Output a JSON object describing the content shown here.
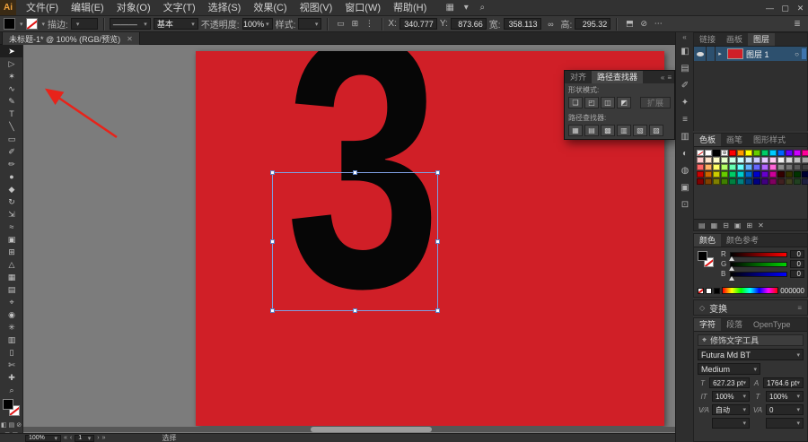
{
  "menubar": {
    "logo": "Ai",
    "items": [
      "文件(F)",
      "编辑(E)",
      "对象(O)",
      "文字(T)",
      "选择(S)",
      "效果(C)",
      "视图(V)",
      "窗口(W)",
      "帮助(H)"
    ],
    "right_icons": [
      {
        "name": "arrange-documents-icon",
        "glyph": "▦"
      },
      {
        "name": "workspace-icon",
        "glyph": "▾"
      },
      {
        "name": "search-icon",
        "glyph": "⌕"
      }
    ],
    "window_controls": [
      {
        "name": "minimize-button",
        "glyph": "—"
      },
      {
        "name": "maximize-button",
        "glyph": "▢"
      },
      {
        "name": "close-button",
        "glyph": "✕"
      }
    ]
  },
  "controlbar": {
    "fill_color": "#000000",
    "stroke_label": "描边:",
    "stroke_weight": "",
    "profile_value": "———",
    "brush_value": "基本",
    "opacity_label": "不透明度:",
    "opacity_value": "100%",
    "style_label": "样式:",
    "x_label": "X:",
    "x_value": "340.777",
    "y_label": "Y:",
    "y_value": "873.66",
    "w_label": "宽:",
    "w_value": "358.113",
    "link_icon": "∞",
    "h_label": "高:",
    "h_value": "295.32",
    "icons_a": [
      {
        "name": "boundingbox-icon",
        "glyph": "▭"
      },
      {
        "name": "align-objects-icon",
        "glyph": "⊞"
      },
      {
        "name": "distribute-icon",
        "glyph": "⋮"
      }
    ],
    "icons_b": [
      {
        "name": "transform-panel-icon",
        "glyph": "⬒"
      },
      {
        "name": "isolate-selection-icon",
        "glyph": "⊘"
      },
      {
        "name": "more-options-icon",
        "glyph": "⋯"
      }
    ],
    "panel_menu_icon": "≣"
  },
  "tabbar": {
    "title": "未标题-1* @ 100% (RGB/预览)",
    "close": "✕"
  },
  "toolbar": {
    "tools": [
      {
        "name": "selection-tool",
        "glyph": "➤"
      },
      {
        "name": "direct-selection-tool",
        "glyph": "▷"
      },
      {
        "name": "magic-wand-tool",
        "glyph": "✶"
      },
      {
        "name": "lasso-tool",
        "glyph": "∿"
      },
      {
        "name": "pen-tool",
        "glyph": "✎"
      },
      {
        "name": "type-tool",
        "glyph": "T"
      },
      {
        "name": "line-segment-tool",
        "glyph": "╲"
      },
      {
        "name": "rectangle-tool",
        "glyph": "▭"
      },
      {
        "name": "paintbrush-tool",
        "glyph": "✐"
      },
      {
        "name": "pencil-tool",
        "glyph": "✏"
      },
      {
        "name": "blob-brush-tool",
        "glyph": "●"
      },
      {
        "name": "eraser-tool",
        "glyph": "◆"
      },
      {
        "name": "rotate-tool",
        "glyph": "↻"
      },
      {
        "name": "scale-tool",
        "glyph": "⇲"
      },
      {
        "name": "width-tool",
        "glyph": "≈"
      },
      {
        "name": "free-transform-tool",
        "glyph": "▣"
      },
      {
        "name": "shape-builder-tool",
        "glyph": "⊞"
      },
      {
        "name": "perspective-grid-tool",
        "glyph": "△"
      },
      {
        "name": "mesh-tool",
        "glyph": "▦"
      },
      {
        "name": "gradient-tool",
        "glyph": "▤"
      },
      {
        "name": "eyedropper-tool",
        "glyph": "⌖"
      },
      {
        "name": "blend-tool",
        "glyph": "◉"
      },
      {
        "name": "symbol-sprayer-tool",
        "glyph": "✳"
      },
      {
        "name": "column-graph-tool",
        "glyph": "▥"
      },
      {
        "name": "artboard-tool",
        "glyph": "▯"
      },
      {
        "name": "slice-tool",
        "glyph": "✄"
      },
      {
        "name": "hand-tool",
        "glyph": "✚"
      },
      {
        "name": "zoom-tool",
        "glyph": "⌕"
      }
    ],
    "mini_icons": [
      {
        "name": "color-mode-icon",
        "glyph": "◧"
      },
      {
        "name": "gradient-mode-icon",
        "glyph": "▤"
      },
      {
        "name": "none-mode-icon",
        "glyph": "⊘"
      }
    ],
    "mode_icons": [
      {
        "name": "draw-mode-icon",
        "glyph": "▢"
      },
      {
        "name": "screen-mode-icon",
        "glyph": "◱"
      }
    ]
  },
  "canvas": {
    "number": "3"
  },
  "pathfinder": {
    "tabs": [
      "对齐",
      "路径查找器"
    ],
    "head_icons": [
      {
        "name": "panel-collapse-icon",
        "glyph": "«"
      },
      {
        "name": "panel-menu-icon",
        "glyph": "≡"
      }
    ],
    "shape_modes_label": "形状模式:",
    "shape_mode_buttons": [
      {
        "name": "unite-button",
        "glyph": "❑"
      },
      {
        "name": "minus-front-button",
        "glyph": "◰"
      },
      {
        "name": "intersect-button",
        "glyph": "◫"
      },
      {
        "name": "exclude-button",
        "glyph": "◩"
      }
    ],
    "expand_label": "扩展",
    "pathfinders_label": "路径查找器:",
    "pathfinder_buttons": [
      {
        "name": "divide-button",
        "glyph": "▦"
      },
      {
        "name": "trim-button",
        "glyph": "▤"
      },
      {
        "name": "merge-button",
        "glyph": "▩"
      },
      {
        "name": "crop-button",
        "glyph": "▥"
      },
      {
        "name": "outline-button",
        "glyph": "▧"
      },
      {
        "name": "minus-back-button",
        "glyph": "▨"
      }
    ]
  },
  "dock": {
    "collapse_icon": "«",
    "icons": [
      {
        "name": "color-panel-icon",
        "glyph": "◧"
      },
      {
        "name": "swatches-panel-icon",
        "glyph": "▤"
      },
      {
        "name": "brushes-panel-icon",
        "glyph": "✐"
      },
      {
        "name": "symbols-panel-icon",
        "glyph": "✦"
      },
      {
        "name": "stroke-panel-icon",
        "glyph": "≡"
      },
      {
        "name": "gradient-panel-icon",
        "glyph": "▥"
      },
      {
        "name": "transparency-panel-icon",
        "glyph": "◐"
      },
      {
        "name": "appearance-panel-icon",
        "glyph": "◍"
      },
      {
        "name": "graphic-styles-panel-icon",
        "glyph": "▣"
      },
      {
        "name": "links-panel-icon",
        "glyph": "⊡"
      }
    ]
  },
  "layers_panel": {
    "tabs": [
      "链接",
      "画板",
      "图层"
    ],
    "layer": {
      "label": "图层 1",
      "expand_icon": "▸",
      "target_icon": "○"
    }
  },
  "swatches_panel": {
    "tabs": [
      "色板",
      "画笔",
      "图形样式"
    ],
    "grid": [
      [
        "NONE",
        "#ffffff",
        "#000000",
        "REG",
        "#ff0000",
        "#ff9900",
        "#ffff00",
        "#66cc00",
        "#00cc66",
        "#00ccff",
        "#0066ff",
        "#6600ff",
        "#cc00ff",
        "#ff0099"
      ],
      [
        "#ffcccc",
        "#ffe6cc",
        "#ffffcc",
        "#e6ffcc",
        "#ccffe6",
        "#ccffff",
        "#cce6ff",
        "#ccccff",
        "#e6ccff",
        "#ffccf2",
        "#f2f2f2",
        "#d9d9d9",
        "#bfbfbf",
        "#a6a6a6"
      ],
      [
        "#ff6666",
        "#ffb366",
        "#ffff66",
        "#b3ff66",
        "#66ffb3",
        "#66ffff",
        "#66b3ff",
        "#6666ff",
        "#b366ff",
        "#ff66d9",
        "#8c8c8c",
        "#737373",
        "#595959",
        "#404040"
      ],
      [
        "#cc0000",
        "#cc6600",
        "#cccc00",
        "#66cc00",
        "#00cc66",
        "#00cccc",
        "#0066cc",
        "#0000cc",
        "#6600cc",
        "#cc0099",
        "#330000",
        "#333300",
        "#003300",
        "#000033"
      ],
      [
        "#800000",
        "#804000",
        "#808000",
        "#408000",
        "#008040",
        "#008080",
        "#004080",
        "#000080",
        "#400080",
        "#800060",
        "#402020",
        "#404020",
        "#204020",
        "#202040"
      ]
    ],
    "footer_icons": [
      {
        "name": "swatch-libraries-icon",
        "glyph": "▤"
      },
      {
        "name": "swatch-kinds-icon",
        "glyph": "▦"
      },
      {
        "name": "swatch-options-icon",
        "glyph": "⊟"
      },
      {
        "name": "new-color-group-icon",
        "glyph": "▣"
      },
      {
        "name": "new-swatch-icon",
        "glyph": "⊞"
      },
      {
        "name": "delete-swatch-icon",
        "glyph": "✕"
      }
    ]
  },
  "color_panel": {
    "tabs": [
      "颜色",
      "颜色参考"
    ],
    "sliders": [
      {
        "name": "red-slider",
        "label": "R",
        "color": "#ff0000",
        "value": "0"
      },
      {
        "name": "green-slider",
        "label": "G",
        "color": "#00d400",
        "value": "0"
      },
      {
        "name": "blue-slider",
        "label": "B",
        "color": "#0000ff",
        "value": "0"
      }
    ],
    "hex": "000000"
  },
  "transform_panel": {
    "icon": "◇",
    "label": "变换",
    "menu_icon": "≡"
  },
  "character_panel": {
    "tabs": [
      "字符",
      "段落",
      "OpenType"
    ],
    "touch_icon": "⌖",
    "touch_label": "修饰文字工具",
    "font": "Futura Md BT",
    "style": "Medium",
    "size_icon": "T",
    "size_value": "627.23 pt",
    "leading_icon": "A",
    "leading_value": "1764.6 pt",
    "vscale_icon": "IT",
    "vscale_value": "100%",
    "hscale_icon": "T",
    "hscale_value": "100%",
    "kerning_icon": "V⁄A",
    "kerning_value": "自动",
    "tracking_icon": "VA",
    "tracking_value": "0"
  },
  "statusbar": {
    "zoom": "100%",
    "nav_first": "«",
    "nav_prev": "‹",
    "artboard_number": "1",
    "nav_next": "›",
    "nav_last": "»",
    "status": "选择"
  }
}
